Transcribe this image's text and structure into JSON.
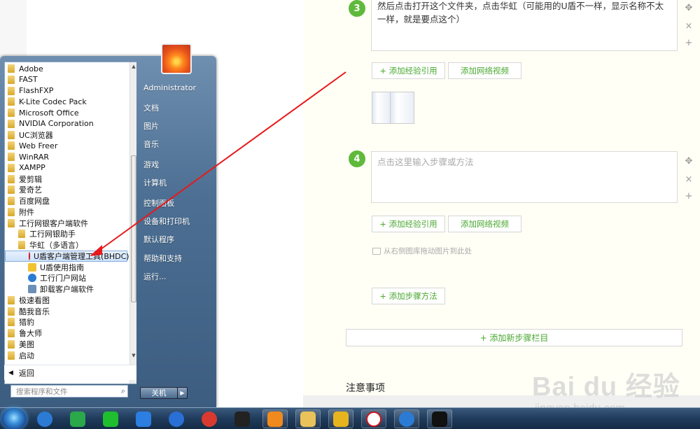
{
  "editor": {
    "step3": {
      "number": "3",
      "text": "然后点击打开这个文件夹，点击华虹（可能用的U盾不一样，显示名称不太一样，就是要点这个）"
    },
    "step4": {
      "number": "4",
      "placeholder": "点击这里输入步骤或方法"
    },
    "add_reference": "+ 添加经验引用",
    "add_video": "添加网络视频",
    "drag_hint": "从右侧图库拖动图片到此处",
    "add_method": "+ 添加步骤方法",
    "add_step_bar": "+ 添加新步骤栏目",
    "notes_heading": "注意事项",
    "tools": {
      "move": "✥",
      "close": "×",
      "add": "+"
    }
  },
  "watermark": {
    "text": "Bai du 经验",
    "url": "jingyan.baidu.com"
  },
  "start_menu": {
    "programs": [
      {
        "label": "Adobe",
        "icon": "folder-icon"
      },
      {
        "label": "FAST",
        "icon": "folder-icon"
      },
      {
        "label": "FlashFXP",
        "icon": "folder-icon"
      },
      {
        "label": "K-Lite Codec Pack",
        "icon": "folder-icon"
      },
      {
        "label": "Microsoft Office",
        "icon": "folder-icon"
      },
      {
        "label": "NVIDIA Corporation",
        "icon": "folder-icon"
      },
      {
        "label": "UC浏览器",
        "icon": "folder-icon"
      },
      {
        "label": "Web Freer",
        "icon": "folder-icon"
      },
      {
        "label": "WinRAR",
        "icon": "folder-icon"
      },
      {
        "label": "XAMPP",
        "icon": "folder-icon"
      },
      {
        "label": "爱剪辑",
        "icon": "folder-icon"
      },
      {
        "label": "爱奇艺",
        "icon": "folder-icon"
      },
      {
        "label": "百度网盘",
        "icon": "folder-icon"
      },
      {
        "label": "附件",
        "icon": "folder-icon"
      },
      {
        "label": "工行网银客户端软件",
        "icon": "folder-icon"
      },
      {
        "label": "工行网银助手",
        "icon": "folder-icon"
      },
      {
        "label": "华虹（多语言）",
        "icon": "folder-icon"
      },
      {
        "label": "U盾客户端管理工具(BHDC)",
        "icon": "icbc-icon"
      },
      {
        "label": "U盾使用指南",
        "icon": "help-doc-icon"
      },
      {
        "label": "工行门户网站",
        "icon": "ie-icon"
      },
      {
        "label": "卸载客户端软件",
        "icon": "uninstall-icon"
      },
      {
        "label": "极速看图",
        "icon": "folder-icon"
      },
      {
        "label": "酷我音乐",
        "icon": "folder-icon"
      },
      {
        "label": "猎豹",
        "icon": "folder-icon"
      },
      {
        "label": "鲁大师",
        "icon": "folder-icon"
      },
      {
        "label": "美图",
        "icon": "folder-icon"
      },
      {
        "label": "启动",
        "icon": "folder-icon"
      }
    ],
    "back": "返回",
    "search_placeholder": "搜索程序和文件",
    "right_items": [
      "Administrator",
      "文档",
      "图片",
      "音乐",
      "游戏",
      "计算机",
      "控制面板",
      "设备和打印机",
      "默认程序",
      "帮助和支持",
      "运行..."
    ],
    "shutdown": "关机"
  },
  "taskbar": {
    "icons": [
      "ie-icon",
      "media-player-icon",
      "iqiyi-icon",
      "feige-icon",
      "baidu-netdisk-icon",
      "netease-music-icon",
      "g-app-icon",
      "uc-browser-icon",
      "file-explorer-icon",
      "notepad-icon",
      "icbc-icon",
      "ie-icon",
      "qq-icon"
    ]
  }
}
